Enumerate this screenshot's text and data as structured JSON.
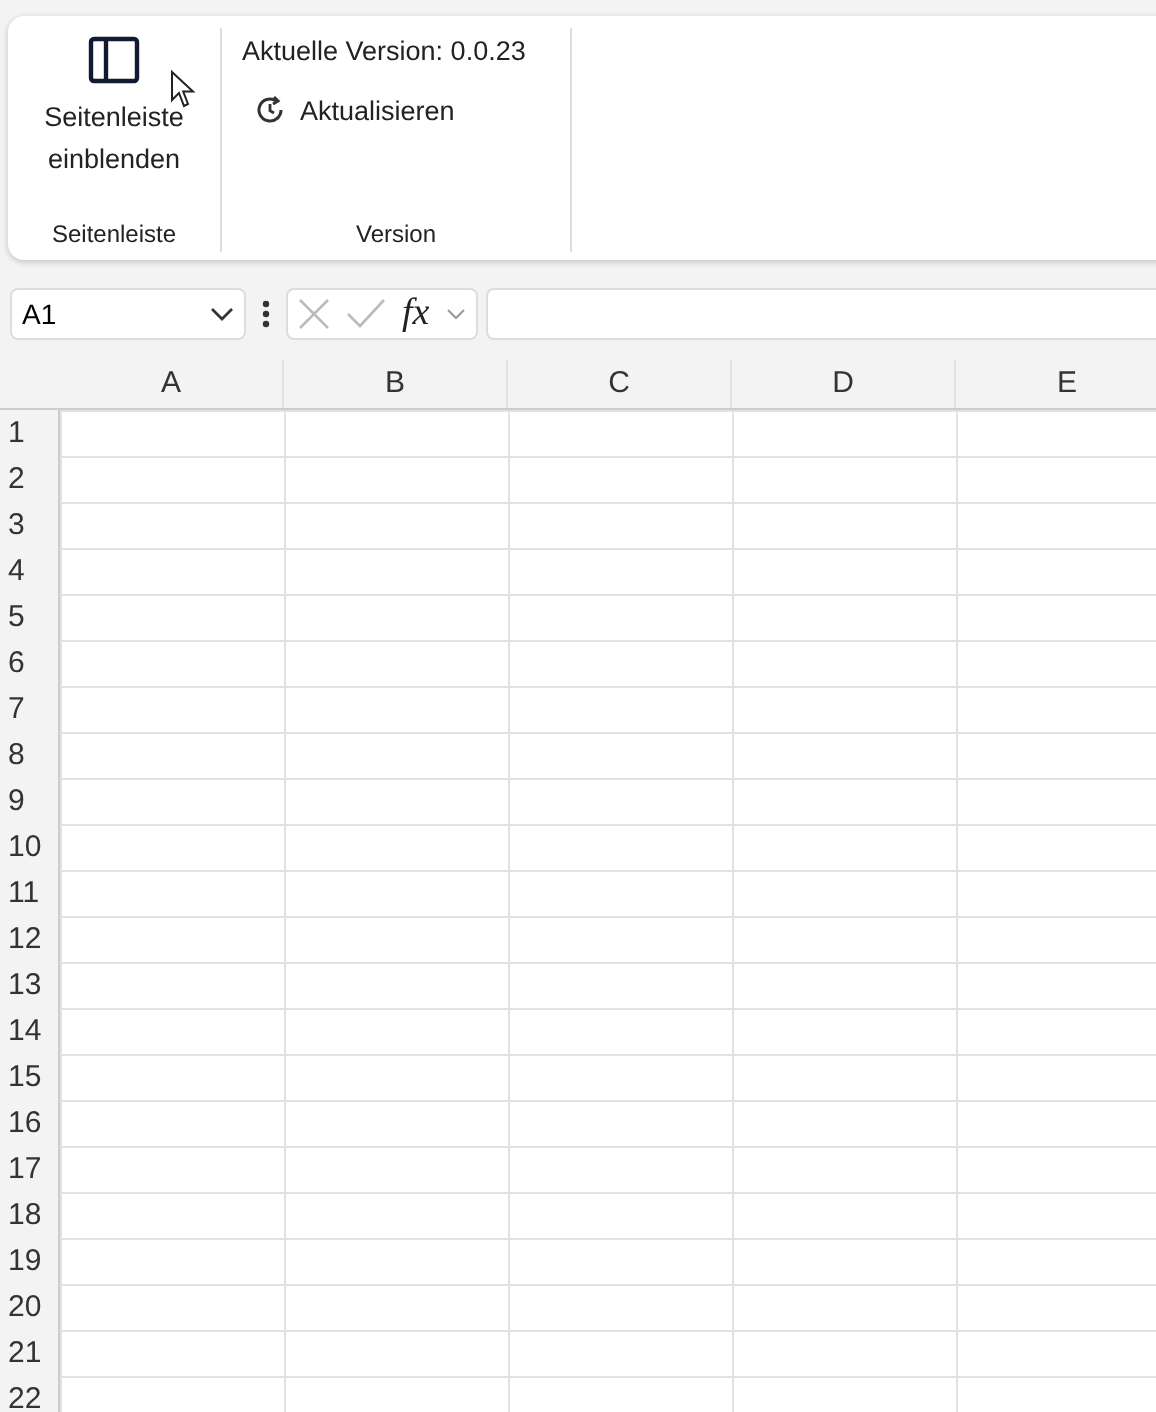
{
  "ribbon": {
    "groups": [
      {
        "label": "Seitenleiste",
        "items": [
          {
            "kind": "large_button",
            "label": "Seitenleiste einblenden"
          }
        ]
      },
      {
        "label": "Version",
        "items": [
          {
            "kind": "text",
            "label": "Aktuelle Version: 0.0.23"
          },
          {
            "kind": "small_button",
            "label": "Aktualisieren"
          }
        ]
      }
    ]
  },
  "formula_bar": {
    "name_box": "A1",
    "fx": "fx"
  },
  "sheet": {
    "columns": [
      "A",
      "B",
      "C",
      "D",
      "E"
    ],
    "rows": [
      "1",
      "2",
      "3",
      "4",
      "5",
      "6",
      "7",
      "8",
      "9",
      "10",
      "11",
      "12",
      "13",
      "14",
      "15",
      "16",
      "17",
      "18",
      "19",
      "20",
      "21",
      "22"
    ]
  }
}
